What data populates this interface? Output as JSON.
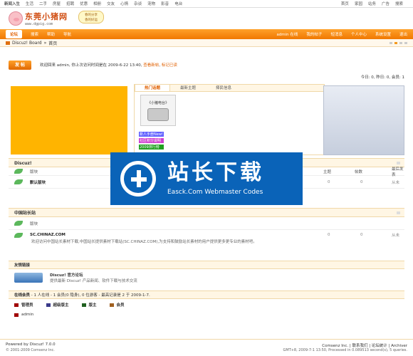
{
  "topbar": {
    "left": [
      "新闻入生",
      "生活",
      "二手",
      "房屋",
      "招聘",
      "优惠",
      "相册",
      "交友",
      "心情",
      "杂谈",
      "宠物",
      "影音",
      "电台"
    ],
    "right": [
      "首页",
      "家园",
      "站务",
      "广告",
      "搜索"
    ]
  },
  "header": {
    "logo_title": "东莞小猪网",
    "logo_url": "www.dgpig.com",
    "bubble_line1": "春的分享",
    "bubble_line2": "香的好运"
  },
  "nav": {
    "left": [
      "论坛",
      "搜索",
      "帮助",
      "导航"
    ],
    "right": [
      "admin 在线",
      "我的帖子",
      "短消息",
      "个人中心",
      "系统设置",
      "退出"
    ]
  },
  "breadcrumb": {
    "root": "Discuz! Board",
    "sep": "»",
    "current": "首页"
  },
  "welcome": {
    "post_button": "发 帖",
    "message": "欢迎回来 admin, 你上次访问时间是在 2009-6-22 13:40,",
    "link1": "查看新帖",
    "link2": "标记已读",
    "stats": "今日: 0, 昨日: 0, 会员: 1"
  },
  "tabs": {
    "items": [
      "热门话题",
      "最新主题",
      "择民信息"
    ],
    "image_label": "《小猪电台》",
    "links": [
      "新人手册New!",
      "社区积分说明",
      "2009排行榜"
    ]
  },
  "sections": {
    "discuz": {
      "title": "Discuz!",
      "col_forum": "版块",
      "col_topics": "主题",
      "col_posts": "帖数",
      "col_last": "最后发表",
      "rows": [
        {
          "name": "默认版块",
          "topics": "0",
          "posts": "0",
          "last": "从未"
        }
      ]
    },
    "china": {
      "title": "中国站长站",
      "col_forum": "版块",
      "site_name": "SC.CHINAZ.COM",
      "site_desc": "欢迎访问中国站长素材下载,中国站长提供素材下载站(SC.CHINAZ.COM),为支持和鼓励站长素材的用户提供更多更专业的素材吧。",
      "topics": "0",
      "posts": "0",
      "last": "从未"
    },
    "friends": {
      "title": "友情链接",
      "name": "Discuz! 官方论坛",
      "desc": "提供最新 Discuz! 产品新闻、软件下载与技术交流"
    },
    "online": {
      "label": "在线会员",
      "text": "- 1 人在线 - 1 会员(0 隐身), 0 位游客 - 最高记录是 2 于 2009-1-7.",
      "legend": [
        "管理员",
        "超级版主",
        "版主",
        "会员"
      ],
      "user": "admin"
    }
  },
  "footer": {
    "powered": "Powered by Discuz! 7.0.0",
    "copyright": "© 2001-2009 Comsenz Inc.",
    "right": "Comsenz Inc. | 联系我们 | 论坛统计 | Archiver",
    "gmt": "GMT+8, 2009-7-1 13:50, Processed in 0.089513 second(s), 5 queries."
  },
  "watermark": {
    "zh": "站长下载",
    "en": "Easck.Com Webmaster Codes"
  },
  "colors": {
    "accent": "#ff8a00",
    "watermark_bg": "#0a63b8",
    "yellow": "#ffb400"
  }
}
